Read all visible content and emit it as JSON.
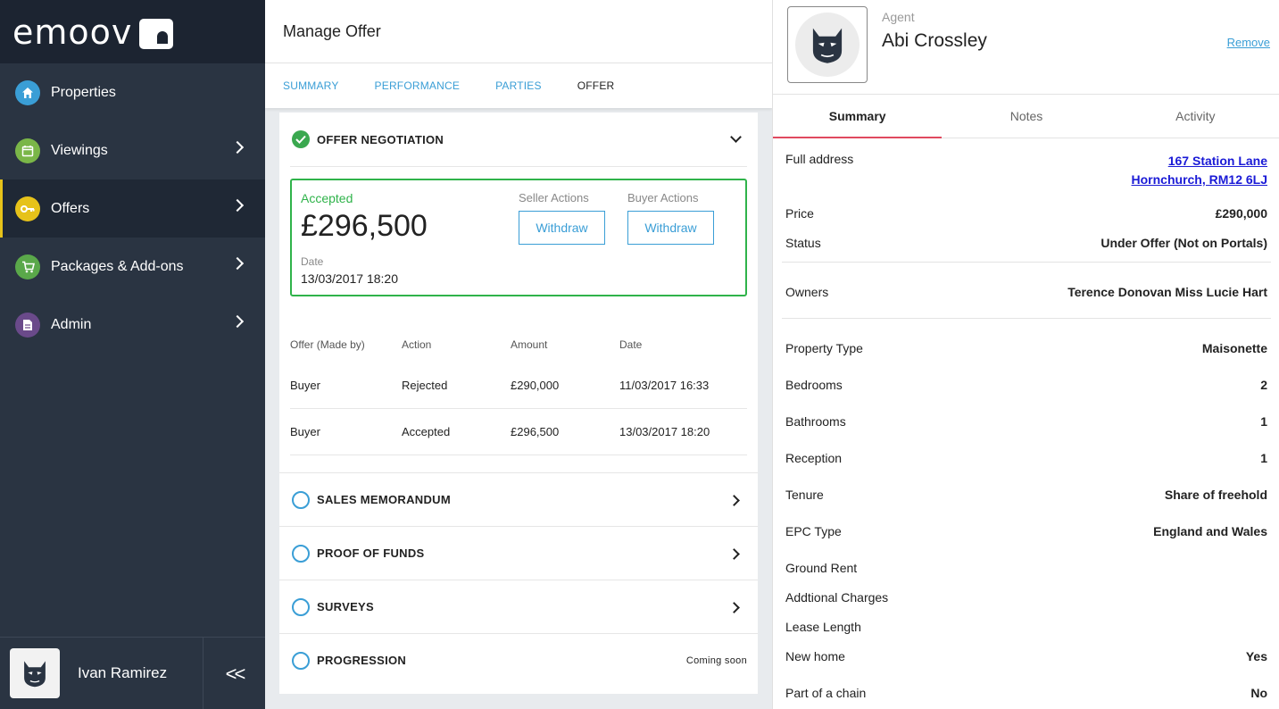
{
  "brand": {
    "logo_text": "emoov"
  },
  "sidebar": {
    "items": [
      {
        "label": "Properties",
        "icon": "home-icon",
        "color": "#3a9ed6"
      },
      {
        "label": "Viewings",
        "icon": "calendar-icon",
        "color": "#7ab648"
      },
      {
        "label": "Offers",
        "icon": "key-icon",
        "color": "#e6c21a"
      },
      {
        "label": "Packages & Add-ons",
        "icon": "cart-icon",
        "color": "#5aa84a"
      },
      {
        "label": "Admin",
        "icon": "document-icon",
        "color": "#6a4a8a"
      }
    ],
    "user_name": "Ivan Ramirez",
    "collapse_glyph": "<<"
  },
  "main": {
    "title": "Manage Offer",
    "tabs": [
      "SUMMARY",
      "PERFORMANCE",
      "PARTIES",
      "OFFER"
    ],
    "sections": {
      "offer_negotiation": "OFFER NEGOTIATION",
      "sales_memorandum": "SALES MEMORANDUM",
      "proof_of_funds": "PROOF OF FUNDS",
      "surveys": "SURVEYS",
      "progression": "PROGRESSION",
      "coming_soon": "Coming soon"
    },
    "accepted": {
      "status": "Accepted",
      "amount": "£296,500",
      "date_label": "Date",
      "date": "13/03/2017 18:20",
      "seller_actions_label": "Seller Actions",
      "buyer_actions_label": "Buyer Actions",
      "withdraw_label": "Withdraw"
    },
    "offers_table": {
      "headers": [
        "Offer (Made by)",
        "Action",
        "Amount",
        "Date"
      ],
      "rows": [
        [
          "Buyer",
          "Rejected",
          "£290,000",
          "11/03/2017 16:33"
        ],
        [
          "Buyer",
          "Accepted",
          "£296,500",
          "13/03/2017 18:20"
        ]
      ]
    }
  },
  "agent": {
    "label": "Agent",
    "name": "Abi Crossley",
    "remove_label": "Remove",
    "tabs": [
      "Summary",
      "Notes",
      "Activity"
    ]
  },
  "property": {
    "address_label": "Full address",
    "address_line1": "167 Station Lane",
    "address_line2": "Hornchurch, RM12 6LJ",
    "price_label": "Price",
    "price": "£290,000",
    "status_label": "Status",
    "status": "Under Offer (Not on Portals)",
    "owners_label": "Owners",
    "owners": "Terence Donovan Miss Lucie Hart",
    "type_label": "Property Type",
    "type": "Maisonette",
    "bedrooms_label": "Bedrooms",
    "bedrooms": "2",
    "bathrooms_label": "Bathrooms",
    "bathrooms": "1",
    "reception_label": "Reception",
    "reception": "1",
    "tenure_label": "Tenure",
    "tenure": "Share of freehold",
    "epc_label": "EPC Type",
    "epc": "England and Wales",
    "ground_rent_label": "Ground Rent",
    "charges_label": "Addtional Charges",
    "lease_label": "Lease Length",
    "new_home_label": "New home",
    "new_home": "Yes",
    "chain_label": "Part of a chain",
    "chain": "No"
  }
}
